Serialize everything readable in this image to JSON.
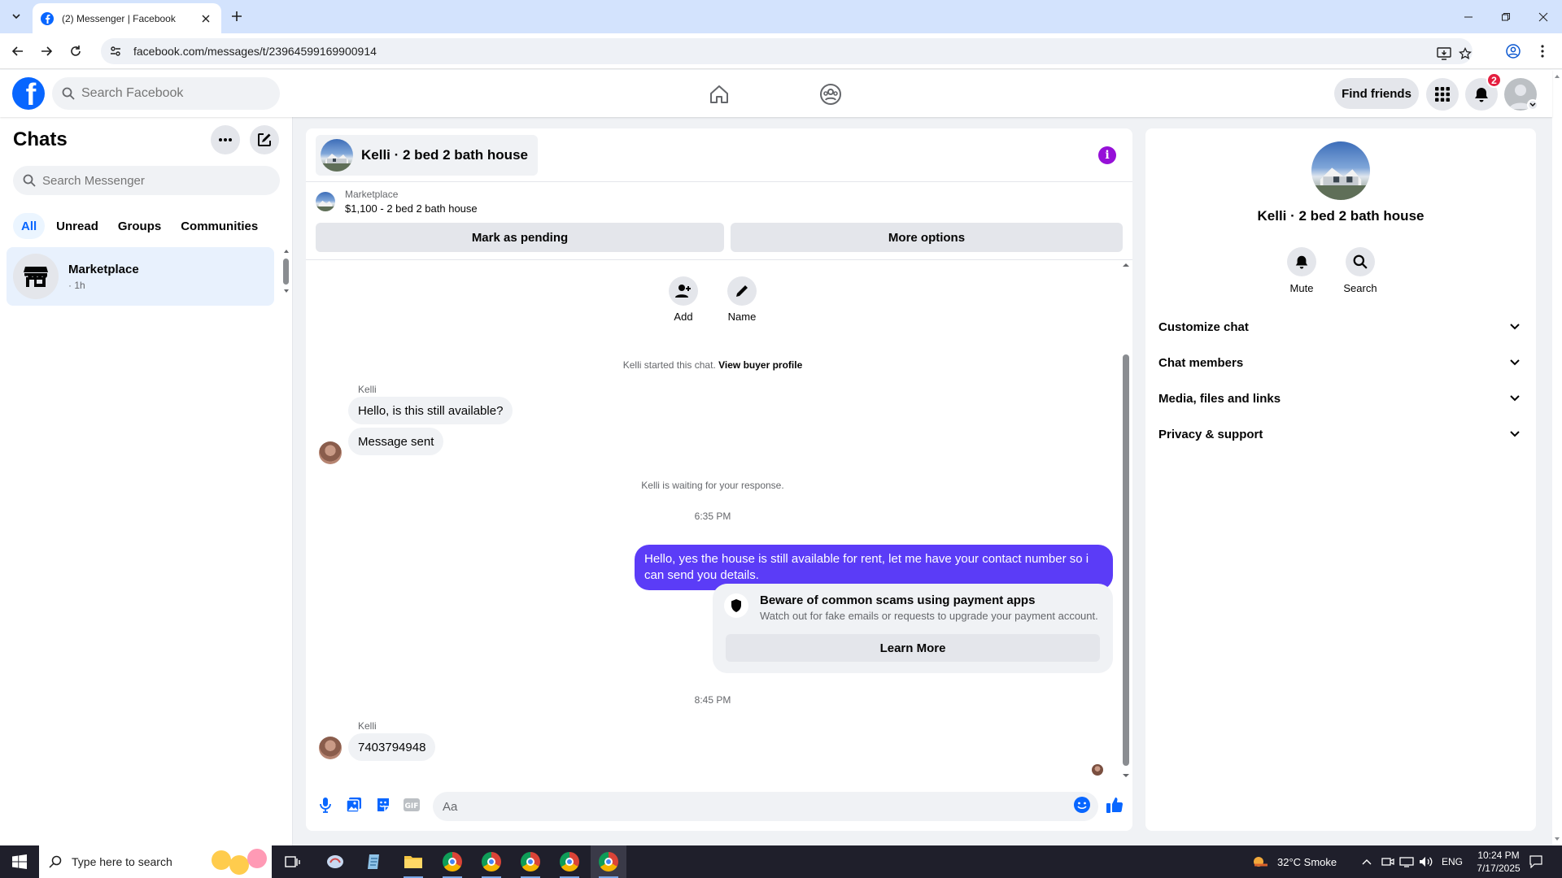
{
  "browser": {
    "tab_title": "(2) Messenger | Facebook",
    "url": "facebook.com/messages/t/23964599169900914"
  },
  "fb_header": {
    "search_placeholder": "Search Facebook",
    "find_friends": "Find friends",
    "notification_count": "2"
  },
  "sidebar": {
    "title": "Chats",
    "search_placeholder": "Search Messenger",
    "tabs": [
      "All",
      "Unread",
      "Groups",
      "Communities"
    ],
    "active_tab": "All",
    "chats": [
      {
        "name": "Marketplace",
        "time": "· 1h"
      }
    ]
  },
  "conversation": {
    "title": "Kelli · 2 bed 2 bath house",
    "listing": {
      "source": "Marketplace",
      "price_title": "$1,100 - 2 bed 2 bath house",
      "mark_pending": "Mark as pending",
      "more_options": "More options"
    },
    "actions": {
      "add": "Add",
      "name": "Name"
    },
    "started_text": "Kelli started this chat.",
    "view_buyer_profile": "View buyer profile",
    "messages": [
      {
        "sender": "Kelli",
        "texts": [
          "Hello, is this still available?",
          "Message sent"
        ]
      }
    ],
    "waiting_text": "Kelli is waiting for your response.",
    "time_1": "6:35 PM",
    "outgoing_message": "Hello, yes the house is still available for rent, let me have your contact number so i can send you details.",
    "scam_card": {
      "title": "Beware of common scams using payment apps",
      "body": "Watch out for fake emails or requests to upgrade your payment account.",
      "button": "Learn More"
    },
    "time_2": "8:45 PM",
    "last_sender": "Kelli",
    "last_message": "7403794948",
    "composer_placeholder": "Aa"
  },
  "info_panel": {
    "name": "Kelli · 2 bed 2 bath house",
    "mute": "Mute",
    "search": "Search",
    "sections": [
      "Customize chat",
      "Chat members",
      "Media, files and links",
      "Privacy & support"
    ]
  },
  "taskbar": {
    "search_placeholder": "Type here to search",
    "weather": "32°C  Smoke",
    "language": "ENG",
    "time": "10:24 PM",
    "date": "7/17/2025"
  },
  "colors": {
    "fb_blue": "#0866ff",
    "outgoing_bubble": "#5b3cf7",
    "info_purple": "#9610d8",
    "badge_red": "#e41e3f"
  }
}
